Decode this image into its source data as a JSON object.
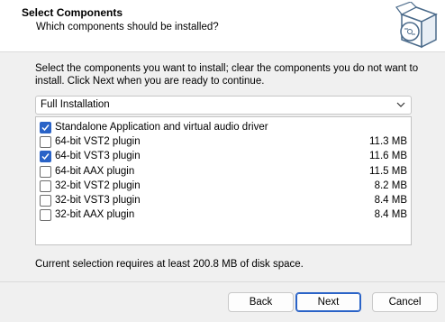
{
  "header": {
    "title": "Select Components",
    "subtitle": "Which components should be installed?",
    "icon": "installer-box-cd-icon"
  },
  "description": "Select the components you want to install; clear the components you do not want to install. Click Next when you are ready to continue.",
  "installation_type": {
    "selected": "Full Installation"
  },
  "components": [
    {
      "label": "Standalone Application and virtual audio driver",
      "size": "",
      "checked": true
    },
    {
      "label": "64-bit VST2 plugin",
      "size": "11.3 MB",
      "checked": false
    },
    {
      "label": "64-bit VST3 plugin",
      "size": "11.6 MB",
      "checked": true
    },
    {
      "label": "64-bit AAX  plugin",
      "size": "11.5 MB",
      "checked": false
    },
    {
      "label": "32-bit VST2 plugin",
      "size": "8.2 MB",
      "checked": false
    },
    {
      "label": "32-bit VST3 plugin",
      "size": "8.4 MB",
      "checked": false
    },
    {
      "label": "32-bit AAX  plugin",
      "size": "8.4 MB",
      "checked": false
    }
  ],
  "disk_space": "Current selection requires at least 200.8 MB of disk space.",
  "buttons": {
    "back": "Back",
    "next": "Next",
    "cancel": "Cancel"
  },
  "colors": {
    "accent": "#2a63c7"
  }
}
